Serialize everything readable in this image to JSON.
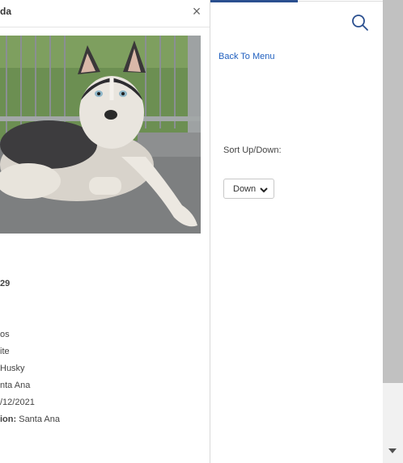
{
  "modal": {
    "title": "da",
    "close_icon": "close-icon",
    "details": {
      "id_value": "29",
      "line1": "os",
      "line2": "ite",
      "line3": "Husky",
      "line4": "nta Ana",
      "line5": "/12/2021",
      "line6_label": "ion:",
      "line6_value": " Santa Ana"
    }
  },
  "header": {
    "search_icon": "search-icon",
    "accent_color": "#2a4f8f"
  },
  "nav": {
    "back_label": "Back To Menu"
  },
  "sort": {
    "label": "Sort Up/Down:",
    "selected": "Down",
    "chevron_icon": "chevron-down-icon"
  },
  "scrollbar": {
    "down_icon": "triangle-down-icon"
  }
}
